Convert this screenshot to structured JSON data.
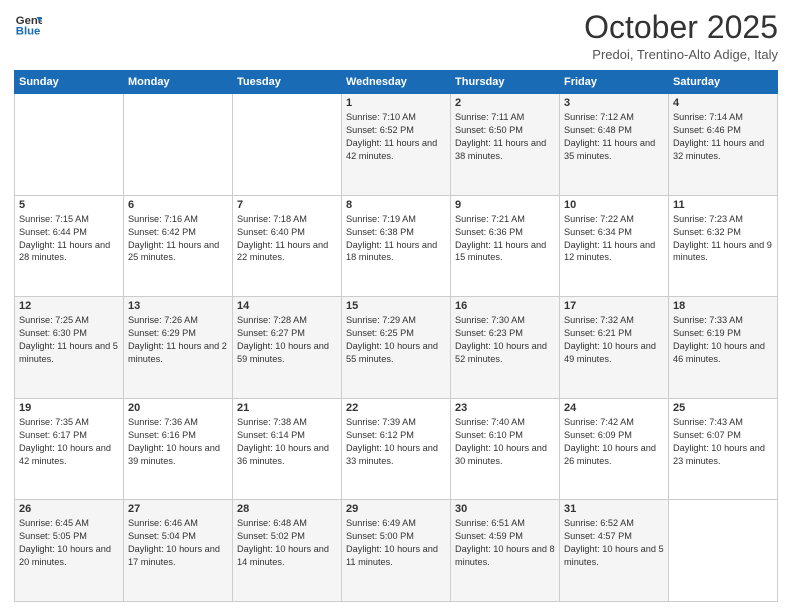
{
  "header": {
    "logo_line1": "General",
    "logo_line2": "Blue",
    "month": "October 2025",
    "location": "Predoi, Trentino-Alto Adige, Italy"
  },
  "columns": [
    "Sunday",
    "Monday",
    "Tuesday",
    "Wednesday",
    "Thursday",
    "Friday",
    "Saturday"
  ],
  "weeks": [
    [
      {
        "day": "",
        "sunrise": "",
        "sunset": "",
        "daylight": ""
      },
      {
        "day": "",
        "sunrise": "",
        "sunset": "",
        "daylight": ""
      },
      {
        "day": "",
        "sunrise": "",
        "sunset": "",
        "daylight": ""
      },
      {
        "day": "1",
        "sunrise": "Sunrise: 7:10 AM",
        "sunset": "Sunset: 6:52 PM",
        "daylight": "Daylight: 11 hours and 42 minutes."
      },
      {
        "day": "2",
        "sunrise": "Sunrise: 7:11 AM",
        "sunset": "Sunset: 6:50 PM",
        "daylight": "Daylight: 11 hours and 38 minutes."
      },
      {
        "day": "3",
        "sunrise": "Sunrise: 7:12 AM",
        "sunset": "Sunset: 6:48 PM",
        "daylight": "Daylight: 11 hours and 35 minutes."
      },
      {
        "day": "4",
        "sunrise": "Sunrise: 7:14 AM",
        "sunset": "Sunset: 6:46 PM",
        "daylight": "Daylight: 11 hours and 32 minutes."
      }
    ],
    [
      {
        "day": "5",
        "sunrise": "Sunrise: 7:15 AM",
        "sunset": "Sunset: 6:44 PM",
        "daylight": "Daylight: 11 hours and 28 minutes."
      },
      {
        "day": "6",
        "sunrise": "Sunrise: 7:16 AM",
        "sunset": "Sunset: 6:42 PM",
        "daylight": "Daylight: 11 hours and 25 minutes."
      },
      {
        "day": "7",
        "sunrise": "Sunrise: 7:18 AM",
        "sunset": "Sunset: 6:40 PM",
        "daylight": "Daylight: 11 hours and 22 minutes."
      },
      {
        "day": "8",
        "sunrise": "Sunrise: 7:19 AM",
        "sunset": "Sunset: 6:38 PM",
        "daylight": "Daylight: 11 hours and 18 minutes."
      },
      {
        "day": "9",
        "sunrise": "Sunrise: 7:21 AM",
        "sunset": "Sunset: 6:36 PM",
        "daylight": "Daylight: 11 hours and 15 minutes."
      },
      {
        "day": "10",
        "sunrise": "Sunrise: 7:22 AM",
        "sunset": "Sunset: 6:34 PM",
        "daylight": "Daylight: 11 hours and 12 minutes."
      },
      {
        "day": "11",
        "sunrise": "Sunrise: 7:23 AM",
        "sunset": "Sunset: 6:32 PM",
        "daylight": "Daylight: 11 hours and 9 minutes."
      }
    ],
    [
      {
        "day": "12",
        "sunrise": "Sunrise: 7:25 AM",
        "sunset": "Sunset: 6:30 PM",
        "daylight": "Daylight: 11 hours and 5 minutes."
      },
      {
        "day": "13",
        "sunrise": "Sunrise: 7:26 AM",
        "sunset": "Sunset: 6:29 PM",
        "daylight": "Daylight: 11 hours and 2 minutes."
      },
      {
        "day": "14",
        "sunrise": "Sunrise: 7:28 AM",
        "sunset": "Sunset: 6:27 PM",
        "daylight": "Daylight: 10 hours and 59 minutes."
      },
      {
        "day": "15",
        "sunrise": "Sunrise: 7:29 AM",
        "sunset": "Sunset: 6:25 PM",
        "daylight": "Daylight: 10 hours and 55 minutes."
      },
      {
        "day": "16",
        "sunrise": "Sunrise: 7:30 AM",
        "sunset": "Sunset: 6:23 PM",
        "daylight": "Daylight: 10 hours and 52 minutes."
      },
      {
        "day": "17",
        "sunrise": "Sunrise: 7:32 AM",
        "sunset": "Sunset: 6:21 PM",
        "daylight": "Daylight: 10 hours and 49 minutes."
      },
      {
        "day": "18",
        "sunrise": "Sunrise: 7:33 AM",
        "sunset": "Sunset: 6:19 PM",
        "daylight": "Daylight: 10 hours and 46 minutes."
      }
    ],
    [
      {
        "day": "19",
        "sunrise": "Sunrise: 7:35 AM",
        "sunset": "Sunset: 6:17 PM",
        "daylight": "Daylight: 10 hours and 42 minutes."
      },
      {
        "day": "20",
        "sunrise": "Sunrise: 7:36 AM",
        "sunset": "Sunset: 6:16 PM",
        "daylight": "Daylight: 10 hours and 39 minutes."
      },
      {
        "day": "21",
        "sunrise": "Sunrise: 7:38 AM",
        "sunset": "Sunset: 6:14 PM",
        "daylight": "Daylight: 10 hours and 36 minutes."
      },
      {
        "day": "22",
        "sunrise": "Sunrise: 7:39 AM",
        "sunset": "Sunset: 6:12 PM",
        "daylight": "Daylight: 10 hours and 33 minutes."
      },
      {
        "day": "23",
        "sunrise": "Sunrise: 7:40 AM",
        "sunset": "Sunset: 6:10 PM",
        "daylight": "Daylight: 10 hours and 30 minutes."
      },
      {
        "day": "24",
        "sunrise": "Sunrise: 7:42 AM",
        "sunset": "Sunset: 6:09 PM",
        "daylight": "Daylight: 10 hours and 26 minutes."
      },
      {
        "day": "25",
        "sunrise": "Sunrise: 7:43 AM",
        "sunset": "Sunset: 6:07 PM",
        "daylight": "Daylight: 10 hours and 23 minutes."
      }
    ],
    [
      {
        "day": "26",
        "sunrise": "Sunrise: 6:45 AM",
        "sunset": "Sunset: 5:05 PM",
        "daylight": "Daylight: 10 hours and 20 minutes."
      },
      {
        "day": "27",
        "sunrise": "Sunrise: 6:46 AM",
        "sunset": "Sunset: 5:04 PM",
        "daylight": "Daylight: 10 hours and 17 minutes."
      },
      {
        "day": "28",
        "sunrise": "Sunrise: 6:48 AM",
        "sunset": "Sunset: 5:02 PM",
        "daylight": "Daylight: 10 hours and 14 minutes."
      },
      {
        "day": "29",
        "sunrise": "Sunrise: 6:49 AM",
        "sunset": "Sunset: 5:00 PM",
        "daylight": "Daylight: 10 hours and 11 minutes."
      },
      {
        "day": "30",
        "sunrise": "Sunrise: 6:51 AM",
        "sunset": "Sunset: 4:59 PM",
        "daylight": "Daylight: 10 hours and 8 minutes."
      },
      {
        "day": "31",
        "sunrise": "Sunrise: 6:52 AM",
        "sunset": "Sunset: 4:57 PM",
        "daylight": "Daylight: 10 hours and 5 minutes."
      },
      {
        "day": "",
        "sunrise": "",
        "sunset": "",
        "daylight": ""
      }
    ]
  ]
}
